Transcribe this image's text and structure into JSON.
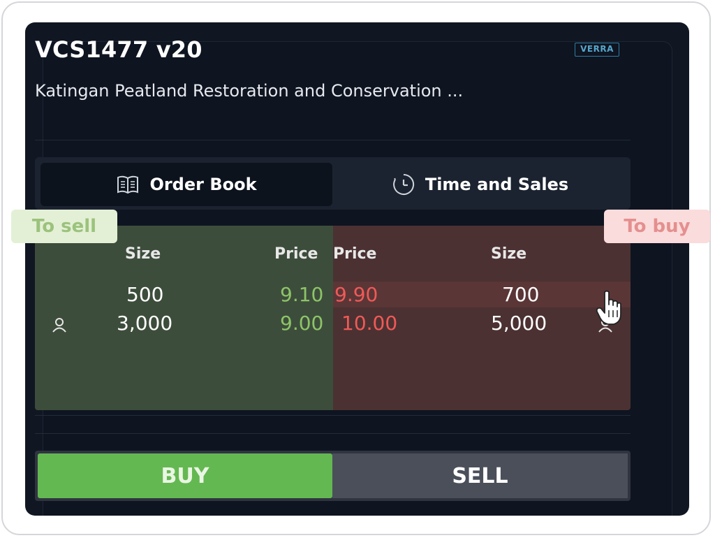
{
  "header": {
    "title": "VCS1477 v20",
    "subtitle": "Katingan Peatland Restoration and Conservation ...",
    "registry_logo": "VERRA"
  },
  "tabs": [
    {
      "label": "Order Book",
      "icon": "book-icon",
      "active": true
    },
    {
      "label": "Time and Sales",
      "icon": "clock-icon",
      "active": false
    }
  ],
  "order_book": {
    "sell_side": {
      "size_header": "Size",
      "price_header": "Price",
      "rows": [
        {
          "size": "500",
          "price": "9.10",
          "own_order": false
        },
        {
          "size": "3,000",
          "price": "9.00",
          "own_order": true
        }
      ]
    },
    "buy_side": {
      "price_header": "Price",
      "size_header": "Size",
      "rows": [
        {
          "price": "9.90",
          "size": "700",
          "own_order": false
        },
        {
          "price": "10.00",
          "size": "5,000",
          "own_order": true
        }
      ]
    }
  },
  "annotations": {
    "to_sell": "To sell",
    "to_buy": "To buy"
  },
  "actions": {
    "buy_label": "BUY",
    "sell_label": "SELL"
  },
  "colors": {
    "panel_bg": "#111722",
    "sell_side_bg": "#3d4d3b",
    "buy_side_bg": "#4c3132",
    "sell_price": "#8dc468",
    "buy_price": "#ef5a57",
    "buy_button": "#64b851",
    "sell_button": "#4a4f5a",
    "verra_blue": "#56a6cc"
  }
}
